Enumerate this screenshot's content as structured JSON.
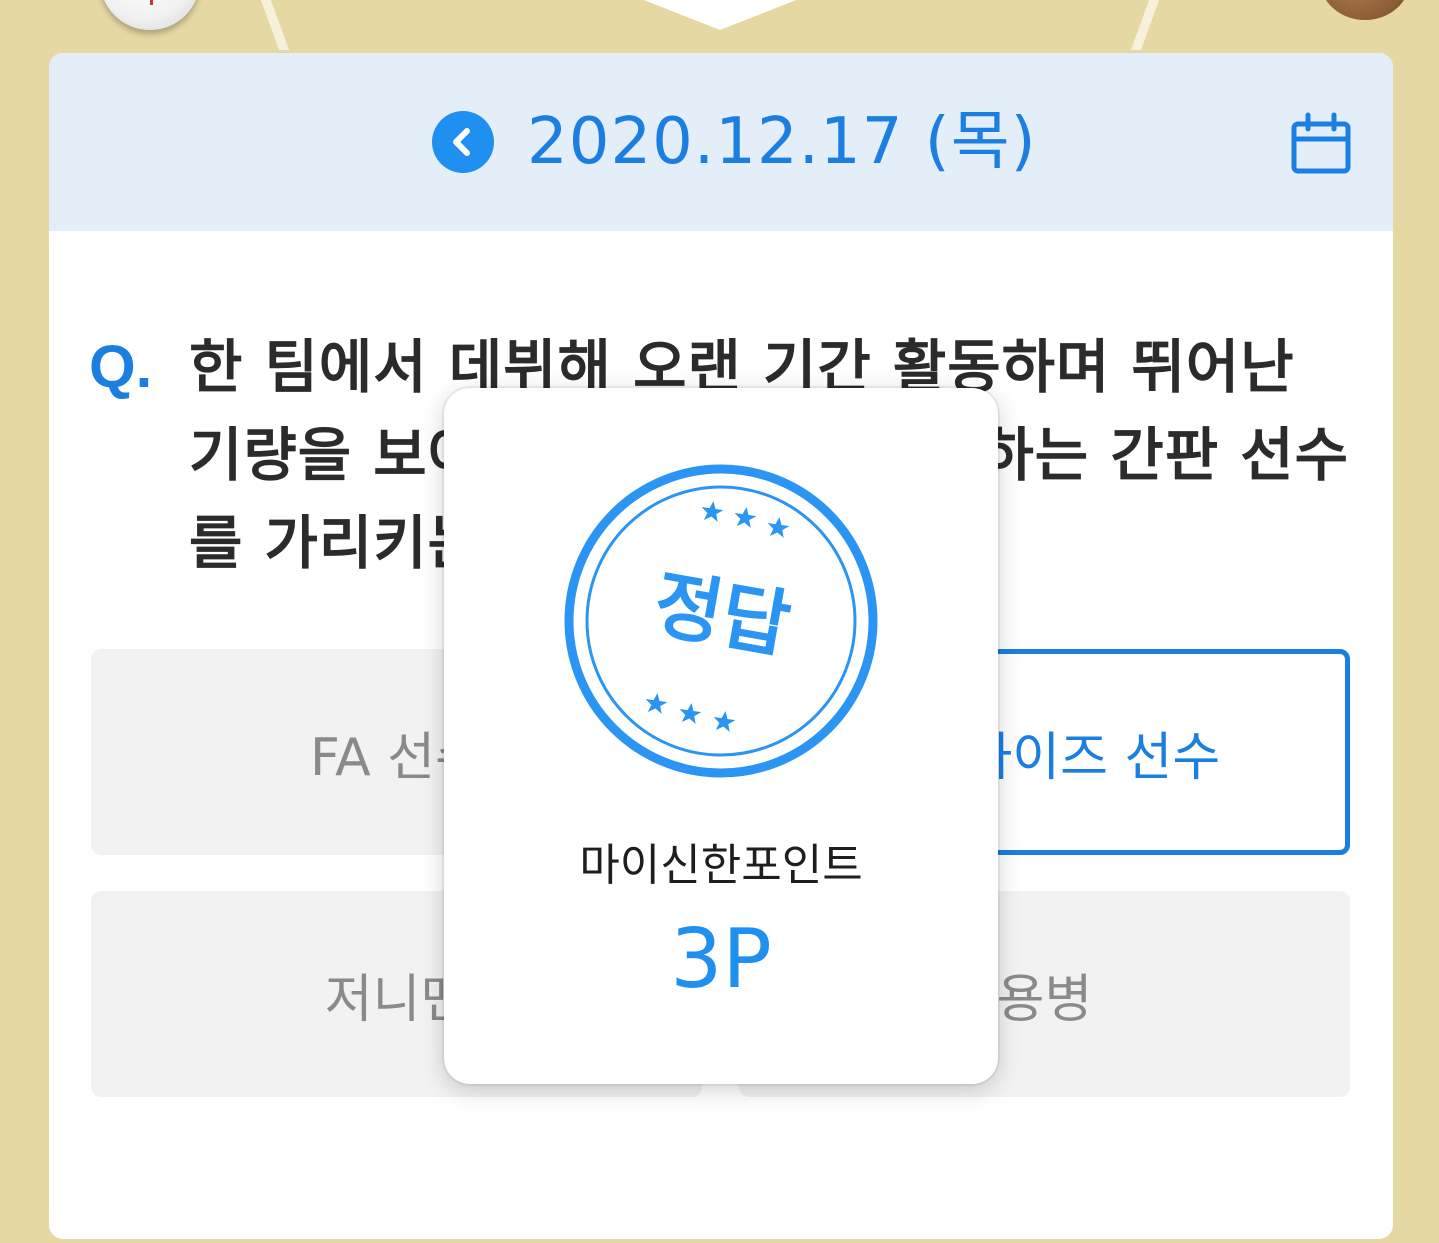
{
  "header": {
    "date": "2020.12.17 (목)"
  },
  "question": {
    "mark": "Q.",
    "text": "한 팀에서 데뷔해 오랜 기간 활동하며 뛰어난 기량을 보여 팀을 대표하고 상징하는 간판 선수를 가리키는 말은?"
  },
  "options": [
    {
      "label": "FA 선수"
    },
    {
      "label": "프랜차이즈 선수"
    },
    {
      "label": "저니맨"
    },
    {
      "label": "용병"
    }
  ],
  "popup": {
    "stamp_text": "정답",
    "label": "마이신한포인트",
    "value": "3P"
  },
  "colors": {
    "accent": "#1f8ff0",
    "header_bg": "#e4eef9",
    "page_bg": "#e6d8a3",
    "selected_border": "#1a7fe0"
  }
}
